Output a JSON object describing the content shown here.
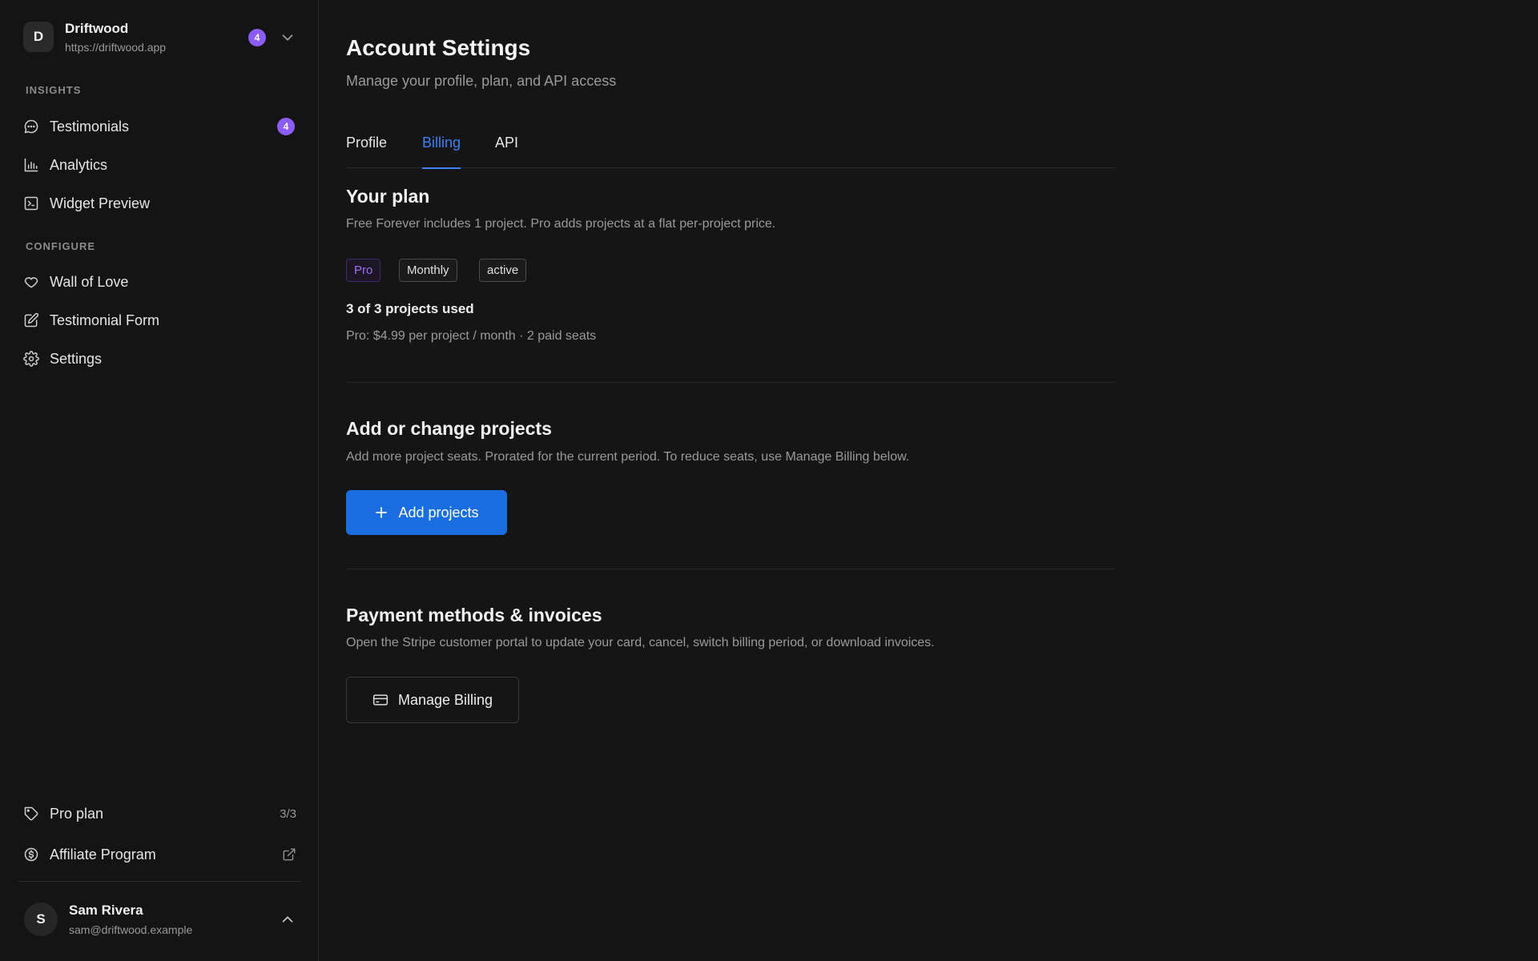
{
  "workspace": {
    "initial": "D",
    "name": "Driftwood",
    "url": "https://driftwood.app",
    "badge": "4"
  },
  "sidebar": {
    "sections": [
      {
        "label": "INSIGHTS"
      },
      {
        "label": "CONFIGURE"
      }
    ],
    "items": [
      {
        "label": "Testimonials",
        "icon": "chat-bubble-icon",
        "badge": "4"
      },
      {
        "label": "Analytics",
        "icon": "bar-chart-icon"
      },
      {
        "label": "Widget Preview",
        "icon": "terminal-icon"
      },
      {
        "label": "Wall of Love",
        "icon": "heart-icon"
      },
      {
        "label": "Testimonial Form",
        "icon": "edit-icon"
      },
      {
        "label": "Settings",
        "icon": "gear-icon"
      }
    ],
    "footer": [
      {
        "label": "Pro plan",
        "icon": "tag-icon",
        "count": "3/3"
      },
      {
        "label": "Affiliate Program",
        "icon": "dollar-circle-icon",
        "trailing_icon": "external-link-icon"
      }
    ],
    "user": {
      "initial": "S",
      "name": "Sam Rivera",
      "email": "sam@driftwood.example"
    }
  },
  "page": {
    "title": "Account Settings",
    "subtitle": "Manage your profile, plan, and API access",
    "tabs": [
      {
        "label": "Profile",
        "active": false
      },
      {
        "label": "Billing",
        "active": true
      },
      {
        "label": "API",
        "active": false
      }
    ]
  },
  "plan": {
    "title": "Your plan",
    "description": "Free Forever includes 1 project. Pro adds projects at a flat per-project price.",
    "chips": [
      "Pro",
      "Monthly",
      "active"
    ],
    "usage_title": "3 of 3 projects used",
    "usage_detail": "Pro: $4.99 per project / month · 2 paid seats"
  },
  "projects": {
    "title": "Add or change projects",
    "description": "Add more project seats. Prorated for the current period. To reduce seats, use Manage Billing below.",
    "button_label": "Add projects"
  },
  "payments": {
    "title": "Payment methods & invoices",
    "description": "Open the Stripe customer portal to update your card, cancel, switch billing period, or download invoices.",
    "button_label": "Manage Billing"
  },
  "colors": {
    "accent": "#3b82f6",
    "primary_button": "#1a6ee0",
    "badge": "#8b5cf6",
    "background": "#151515"
  }
}
